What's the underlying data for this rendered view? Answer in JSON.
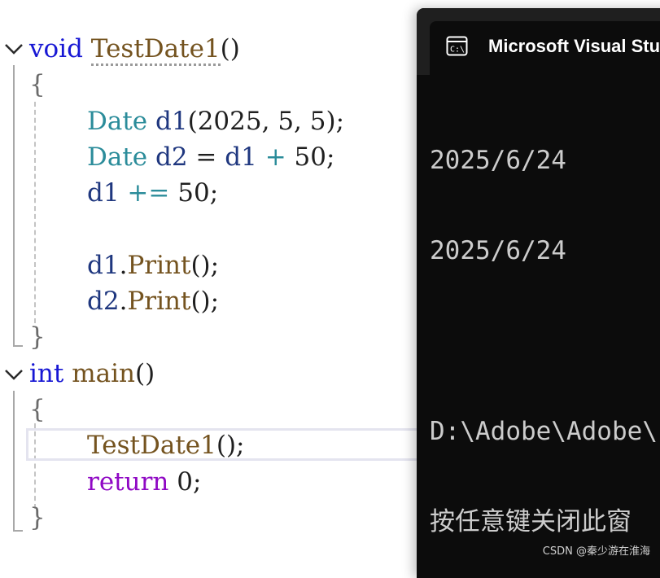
{
  "editor": {
    "lines": [
      {
        "void": "void",
        "fname": "TestDate1",
        "paren": "()"
      },
      {
        "text": "{"
      },
      {
        "type": "Date",
        "var": "d1",
        "rest_open": "(",
        "n1": "2025",
        "sep1": ", ",
        "n2": "5",
        "sep2": ", ",
        "n3": "5",
        "close": ");"
      },
      {
        "type": "Date",
        "var": "d2",
        "eq": " = ",
        "var2": "d1",
        "plus": " + ",
        "num": "50",
        "end": ";"
      },
      {
        "var": "d1",
        "op": " += ",
        "num": "50",
        "end": ";"
      },
      {
        "var": "d1",
        "dot": ".",
        "fn": "Print",
        "end": "();"
      },
      {
        "var": "d2",
        "dot": ".",
        "fn": "Print",
        "end": "();"
      },
      {
        "text": "}"
      },
      {
        "kw": "int",
        "fn": "main",
        "paren": "()"
      },
      {
        "text": "{"
      },
      {
        "fn": "TestDate1",
        "end": "();"
      },
      {
        "kw": "return",
        "num": " 0",
        "end": ";"
      },
      {
        "text": "}"
      }
    ]
  },
  "console": {
    "title": "Microsoft Visual Stu",
    "icon": "console-app-icon",
    "output": [
      "2025/6/24",
      "2025/6/24",
      "",
      "D:\\Adobe\\Adobe\\",
      "按任意键关闭此窗"
    ]
  },
  "watermark": "CSDN @秦少游在淮海",
  "colors": {
    "keyword": "#1717d4",
    "return_keyword": "#8f08c4",
    "type": "#2b8c9a",
    "function": "#74531f",
    "variable": "#1f377f",
    "console_bg": "#0c0c0c",
    "console_text": "#cccccc"
  }
}
